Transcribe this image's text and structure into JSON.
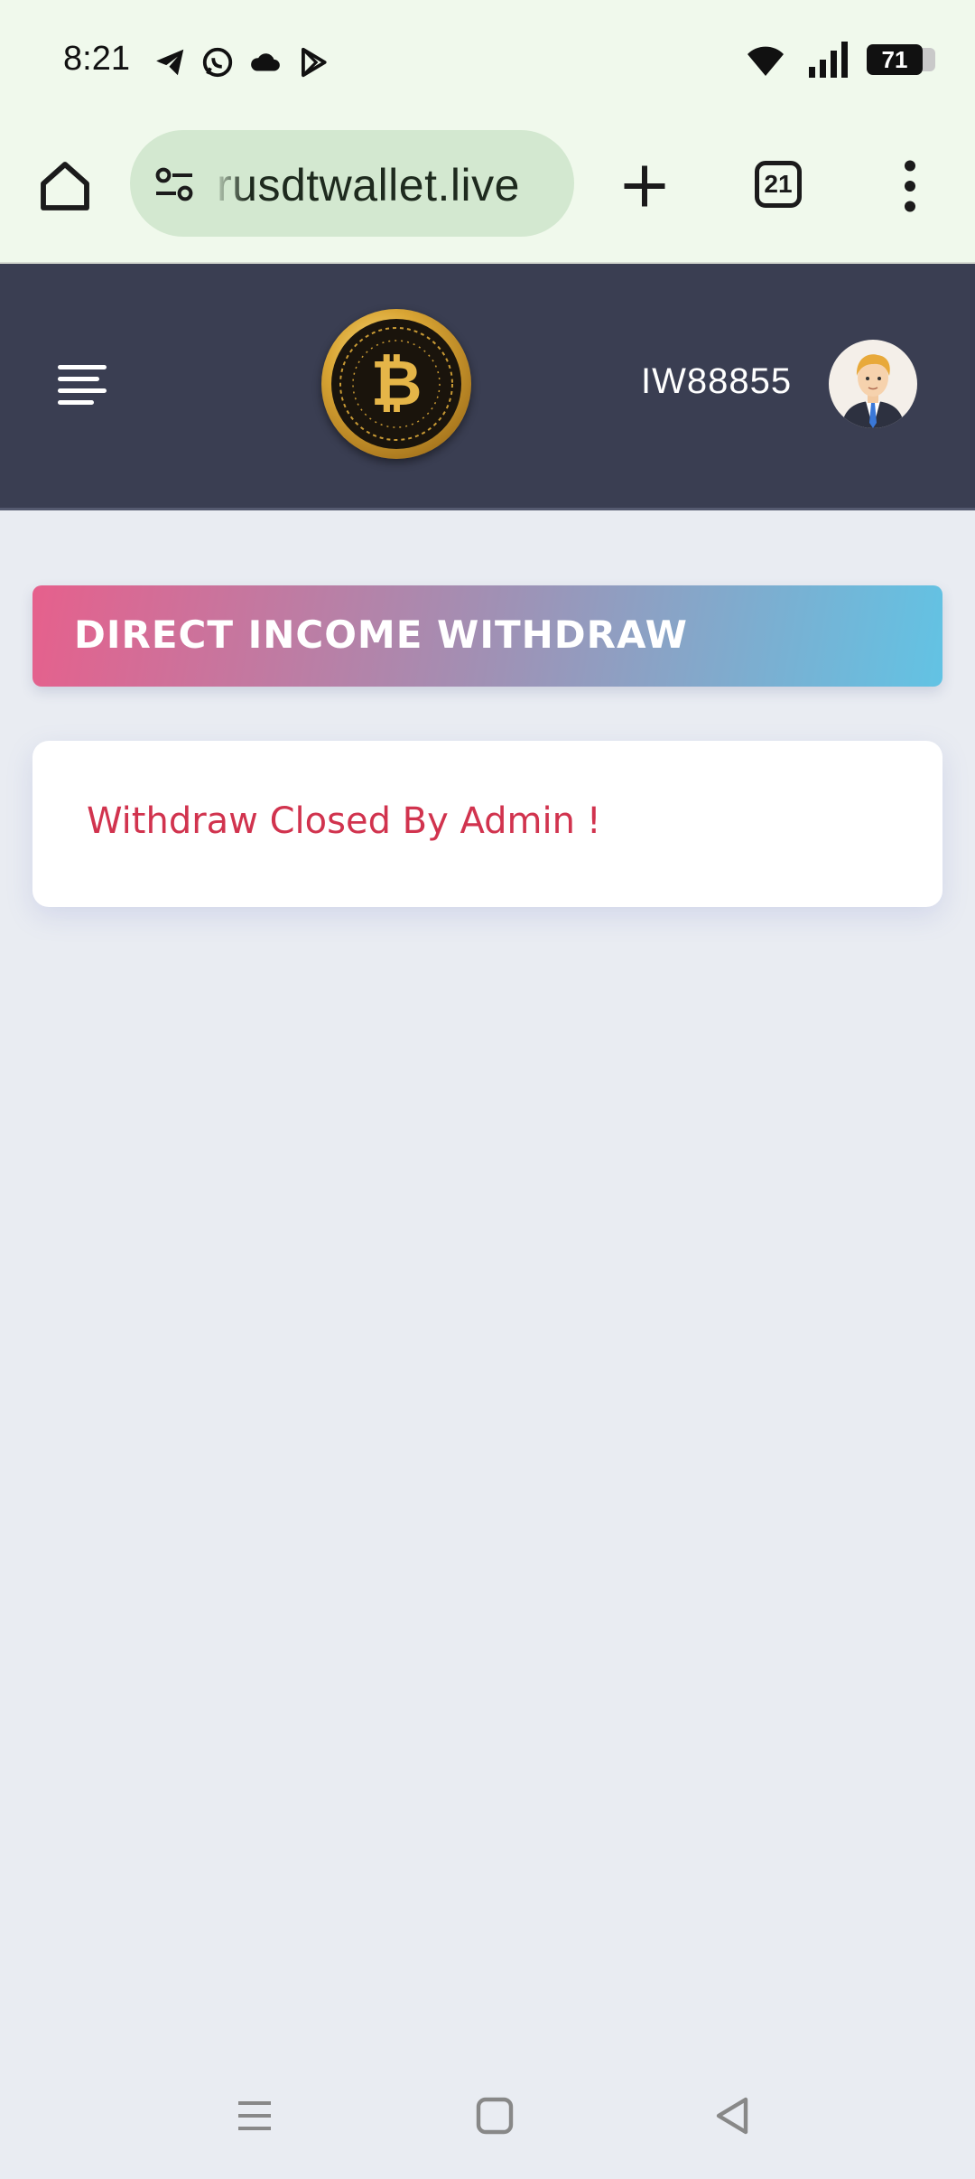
{
  "status_bar": {
    "time": "8:21",
    "battery": "71",
    "left_icons": [
      "telegram-icon",
      "whatsapp-icon",
      "cloud-icon",
      "play-store-icon"
    ],
    "right_icons": [
      "wifi-icon",
      "signal-icon",
      "battery-icon"
    ]
  },
  "browser": {
    "url": "rusdtwallet.live",
    "tab_count": "21",
    "icons": [
      "home-icon",
      "site-settings-icon",
      "plus-icon",
      "tabs-icon",
      "more-vert-icon"
    ]
  },
  "header": {
    "user_id": "IW88855",
    "icons": [
      "menu-icon",
      "bitcoin-logo",
      "avatar"
    ]
  },
  "main": {
    "page_title": "DIRECT INCOME WITHDRAW",
    "message": "Withdraw Closed By Admin !"
  },
  "colors": {
    "header_bg": "#3a3e52",
    "page_bg": "#e9ecf2",
    "title_gradient_start": "#e6608c",
    "title_gradient_end": "#62c3e4",
    "message_color": "#d1334e",
    "browser_bg": "#f0f9ec"
  },
  "nav": {
    "icons": [
      "recents-icon",
      "home-nav-icon",
      "back-icon"
    ]
  }
}
